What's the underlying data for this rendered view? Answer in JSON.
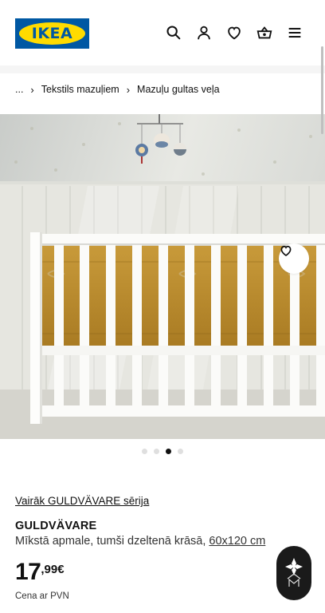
{
  "header": {
    "logo_text": "IKEA",
    "icons": [
      "search-icon",
      "user-icon",
      "heart-icon",
      "basket-icon",
      "menu-icon"
    ]
  },
  "breadcrumb": {
    "ellipsis": "...",
    "items": [
      "Tekstils mazuļiem",
      "Mazuļu gultas veļa"
    ]
  },
  "gallery": {
    "dots": 4,
    "active_index": 2
  },
  "product": {
    "series_link": "Vairāk GULDVÄVARE sērija",
    "name": "GULDVÄVARE",
    "description": "Mīkstā apmale, tumši dzeltenā krāsā, ",
    "size": "60x120 cm",
    "price_int": "17",
    "price_dec": ",99€",
    "vat_note": "Cena ar PVN"
  },
  "colors": {
    "brand_blue": "#0058a3",
    "brand_yellow": "#ffdb00"
  }
}
